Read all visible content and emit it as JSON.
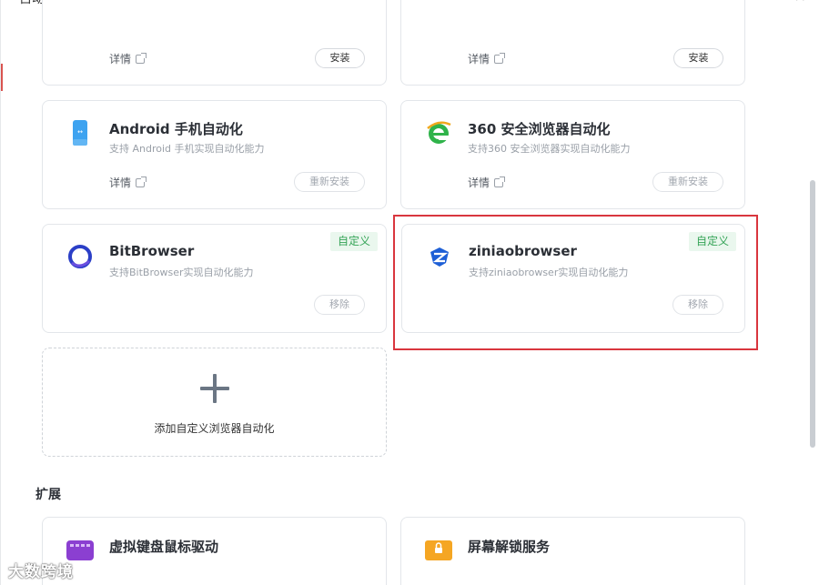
{
  "dialog": {
    "title": "自动化插件",
    "close_label": "×"
  },
  "cards": {
    "top_left": {
      "detail": "详情",
      "button": "安装"
    },
    "top_right": {
      "detail": "详情",
      "button": "安装"
    },
    "android": {
      "title": "Android 手机自动化",
      "desc": "支持 Android 手机实现自动化能力",
      "detail": "详情",
      "button": "重新安装"
    },
    "browser360": {
      "title": "360 安全浏览器自动化",
      "desc": "支持360 安全浏览器实现自动化能力",
      "detail": "详情",
      "button": "重新安装"
    },
    "bitbrowser": {
      "title": "BitBrowser",
      "desc": "支持BitBrowser实现自动化能力",
      "badge": "自定义",
      "button": "移除"
    },
    "ziniao": {
      "title": "ziniaobrowser",
      "desc": "支持ziniaobrowser实现自动化能力",
      "badge": "自定义",
      "button": "移除"
    }
  },
  "add_custom": {
    "label": "添加自定义浏览器自动化"
  },
  "extensions": {
    "title": "扩展",
    "items": [
      {
        "title": "虚拟键盘鼠标驱动"
      },
      {
        "title": "屏幕解锁服务"
      }
    ]
  },
  "watermark": "大数跨境",
  "colors": {
    "accent_badge_bg": "#eaf7ee",
    "accent_badge_text": "#35a457",
    "highlight": "#d9363e"
  }
}
